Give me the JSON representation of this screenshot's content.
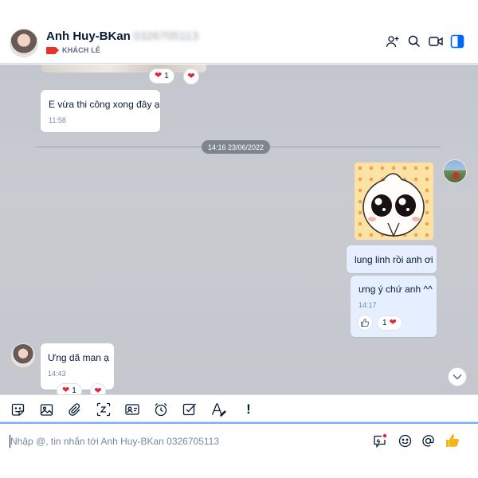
{
  "header": {
    "contact_name": "Anh Huy-BKan",
    "contact_phone": "0326705113",
    "tag_label": "KHÁCH LẺ",
    "tag_color": "#e5322d",
    "icons": [
      "add-member-icon",
      "search-icon",
      "video-call-icon",
      "sidebar-toggle-icon"
    ]
  },
  "messages": {
    "top_reactions": {
      "heart_count": "1"
    },
    "msg1": {
      "text": "E vừa thi công xong đây ạ",
      "time": "11:58"
    },
    "date_divider": "14:16 23/06/2022",
    "msg2": {
      "text": "lung linh rồi anh ơi"
    },
    "msg3": {
      "text": "ưng ý chứ anh ^^",
      "time": "14:17",
      "heart_count": "1"
    },
    "msg4": {
      "text": "Ưng dã man ạ",
      "time": "14:43",
      "heart_count": "1"
    }
  },
  "toolbar": {
    "icons": [
      "sticker-icon",
      "image-icon",
      "attachment-icon",
      "screenshot-icon",
      "contact-card-icon",
      "reminder-icon",
      "task-icon",
      "text-format-icon",
      "urgent-icon"
    ]
  },
  "composer": {
    "placeholder": "Nhập @, tin nhắn tới Anh Huy-BKan 0326705113",
    "icons": [
      "quick-message-icon",
      "emoji-icon",
      "mention-icon",
      "like-icon"
    ]
  },
  "colors": {
    "accent": "#0068ff",
    "own_bubble": "#e5efff",
    "heart": "#e4253c",
    "like": "#f5b418"
  }
}
